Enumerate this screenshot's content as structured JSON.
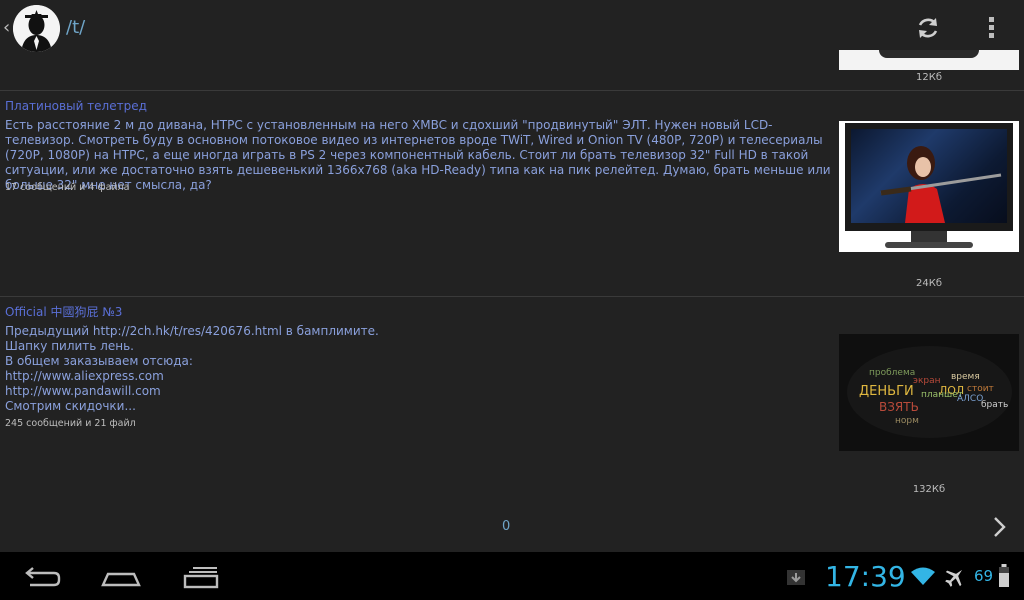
{
  "actionbar": {
    "up_caret": "‹",
    "board": "/t/",
    "refresh_icon": "refresh-icon",
    "overflow_icon": "overflow-menu-icon"
  },
  "top_item": {
    "size": "12Кб"
  },
  "threads": [
    {
      "title": "Платиновый телетред",
      "body": "Есть расстояние 2 м до дивана, HTPC с установленным на него XMBC и сдохший \"продвинутый\" ЭЛТ. Нужен новый LCD-телевизор. Смотреть буду в основном потоковое видео из интернетов вроде TWiT, Wired и Onion TV (480P, 720P) и телесериалы (720P, 1080P) на HTPC, а еще иногда играть в PS 2 через компонентный кабель. Стоит ли брать телевизор 32\" Full HD в такой ситуации, или же достаточно взять дешевенький 1366x768 (aka HD-Ready) типа как на пик релейтед. Думаю, брать меньше или больше 32\" мне нет смысла, да?",
      "meta": "17 сообщений и 4 файла",
      "size": "24Кб"
    },
    {
      "title": "Official 中國狗屁 №3",
      "body": "Предыдущий http://2ch.hk/t/res/420676.html в бамплимите.\nШапку пилить лень.\nВ общем заказываем отсюда:\nhttp://www.aliexpress.com\nhttp://www.pandawill.com\nСмотрим скидочки...",
      "meta": "245 сообщений и 21 файл",
      "size": "132Кб"
    }
  ],
  "cloud_words": [
    "ДЕНЬГИ",
    "ВЗЯТЬ",
    "время",
    "проблема",
    "брать",
    "стоит",
    "ЛОЛ",
    "планшет",
    "экран",
    "АЛСО",
    "норм"
  ],
  "pager": {
    "page": "0"
  },
  "status": {
    "time": "17:39",
    "battery": "69"
  },
  "colors": {
    "accent": "#33b5e5",
    "link": "#8aa0dc",
    "title": "#5a6fd6"
  }
}
